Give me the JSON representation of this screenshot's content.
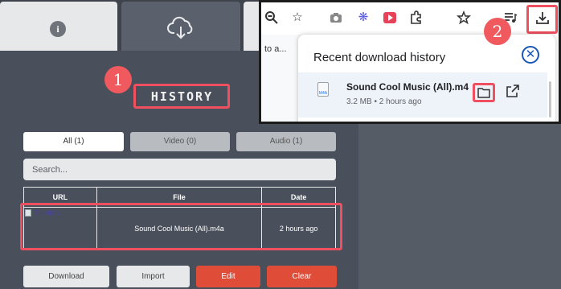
{
  "extension": {
    "tabs": [
      {
        "name": "info",
        "icon": "info-icon"
      },
      {
        "name": "download",
        "icon": "cloud-download-icon"
      },
      {
        "name": "third",
        "icon": ""
      }
    ],
    "title": "HISTORY",
    "filters": [
      "All (1)",
      "Video (0)",
      "Audio (1)"
    ],
    "search_placeholder": "Search...",
    "table": {
      "headers": [
        "URL",
        "File",
        "Date"
      ],
      "rows": [
        {
          "thumbnail_alt": "Thumbnail",
          "file": "Sound Cool Music (All).m4a",
          "date": "2 hours ago"
        }
      ]
    },
    "buttons": {
      "download": "Download",
      "import": "Import",
      "edit": "Edit",
      "clear": "Clear"
    }
  },
  "annotations": {
    "step1": "1",
    "step2": "2"
  },
  "chrome": {
    "page_fragment": "to a...",
    "downloads_panel": {
      "title": "Recent download history",
      "item": {
        "icon_label": "M4A",
        "name": "Sound Cool Music (All).m4",
        "meta": "3.2 MB • 2 hours ago"
      }
    }
  },
  "colors": {
    "highlight": "#ef4f5e",
    "accent_blue": "#1a56b8",
    "clear_red": "#df4c38"
  }
}
